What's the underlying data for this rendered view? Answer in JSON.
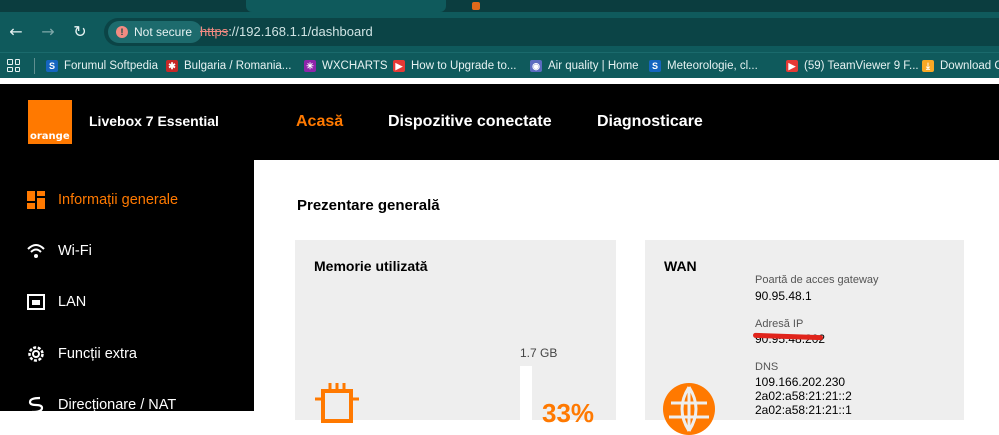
{
  "browser": {
    "security_label": "Not secure",
    "url_scheme": "https",
    "url_rest": "://192.168.1.1/dashboard",
    "bookmarks": [
      {
        "label": "Forumul Softpedia",
        "icon": "softpedia-icon",
        "color": "#1565c0"
      },
      {
        "label": "Bulgaria / Romania...",
        "icon": "flag-icon",
        "color": "#c62828"
      },
      {
        "label": "WXCHARTS",
        "icon": "star-icon",
        "color": "#8e24aa"
      },
      {
        "label": "How to Upgrade to...",
        "icon": "youtube-icon",
        "color": "#e53935"
      },
      {
        "label": "Air quality | Home",
        "icon": "globe-icon",
        "color": "#5c6bc0"
      },
      {
        "label": "Meteorologie, cl...",
        "icon": "softpedia-icon",
        "color": "#1565c0"
      },
      {
        "label": "(59) TeamViewer 9 F...",
        "icon": "youtube-icon",
        "color": "#e53935"
      },
      {
        "label": "Download C",
        "icon": "download-icon",
        "color": "#f9a825"
      }
    ]
  },
  "header": {
    "logo_text": "orange",
    "product": "Livebox 7 Essential",
    "nav": [
      {
        "label": "Acasă",
        "active": true
      },
      {
        "label": "Dispozitive conectate",
        "active": false
      },
      {
        "label": "Diagnosticare",
        "active": false
      }
    ]
  },
  "sidebar": {
    "items": [
      {
        "label": "Informații generale",
        "icon": "dashboard-icon",
        "active": true
      },
      {
        "label": "Wi-Fi",
        "icon": "wifi-icon",
        "active": false
      },
      {
        "label": "LAN",
        "icon": "lan-icon",
        "active": false
      },
      {
        "label": "Funcții extra",
        "icon": "gear-icon",
        "active": false
      },
      {
        "label": "Direcționare / NAT",
        "icon": "routing-icon",
        "active": false
      }
    ]
  },
  "main": {
    "title": "Prezentare generală",
    "memory": {
      "title": "Memorie utilizată",
      "scale": "1.7 GB",
      "percent_text": "33%"
    },
    "wan": {
      "title": "WAN",
      "gateway_label": "Poartă de acces gateway",
      "gateway_value": "90.95.48.1",
      "ip_label": "Adresă IP",
      "ip_value": "90.95.48.202",
      "dns_label": "DNS",
      "dns_values": [
        "109.166.202.230",
        "2a02:a58:21:21::2",
        "2a02:a58:21:21::1"
      ]
    }
  },
  "colors": {
    "accent": "#ff7900",
    "chrome": "#0f5a5c"
  }
}
